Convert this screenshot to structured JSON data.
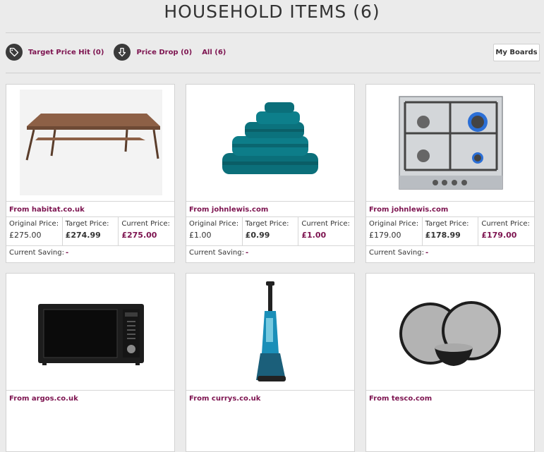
{
  "page": {
    "title": "HOUSEHOLD ITEMS (6)"
  },
  "filters": [
    {
      "label": "Target Price Hit (0)",
      "icon": "tag-icon"
    },
    {
      "label": "Price Drop (0)",
      "icon": "arrow-down-icon"
    },
    {
      "label": "All (6)"
    }
  ],
  "boards_button": "My Boards",
  "labels": {
    "original": "Original Price:",
    "target": "Target Price:",
    "current": "Current Price:",
    "saving": "Current Saving:"
  },
  "colors": {
    "accent": "#7d1450"
  },
  "products": [
    {
      "image": "coffee-table",
      "source": "From habitat.co.uk",
      "original": "£275.00",
      "target": "£274.99",
      "current": "£275.00",
      "saving": "-"
    },
    {
      "image": "teal-towels",
      "source": "From johnlewis.com",
      "original": "£1.00",
      "target": "£0.99",
      "current": "£1.00",
      "saving": "-"
    },
    {
      "image": "gas-hob",
      "source": "From johnlewis.com",
      "original": "£179.00",
      "target": "£178.99",
      "current": "£179.00",
      "saving": "-"
    },
    {
      "image": "microwave",
      "source": "From argos.co.uk"
    },
    {
      "image": "vacuum-cleaner",
      "source": "From currys.co.uk"
    },
    {
      "image": "dinner-set",
      "source": "From tesco.com"
    }
  ]
}
